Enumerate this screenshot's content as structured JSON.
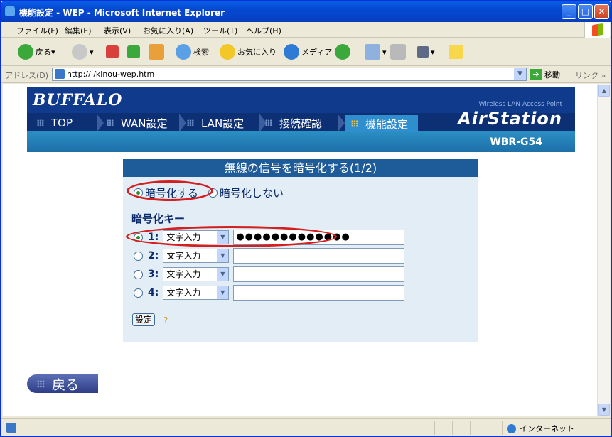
{
  "window": {
    "title": "機能設定 - WEP - Microsoft Internet Explorer"
  },
  "menu": [
    "ファイル(F)",
    "編集(E)",
    "表示(V)",
    "お気に入り(A)",
    "ツール(T)",
    "ヘルプ(H)"
  ],
  "toolbar": {
    "back": "戻る",
    "search": "検索",
    "favorites": "お気に入り",
    "media": "メディア"
  },
  "address": {
    "label": "アドレス(D)",
    "url": "http://            /kinou-wep.htm",
    "go": "移動",
    "links": "リンク"
  },
  "header": {
    "logo": "BUFFALO",
    "tabs": [
      "TOP",
      "WAN設定",
      "LAN設定",
      "接続確認",
      "機能設定"
    ],
    "active_tab": "機能設定",
    "product_sub": "Wireless LAN Access Point",
    "product": "AirStation",
    "model": "WBR-G54"
  },
  "panel": {
    "title": "無線の信号を暗号化する(1/2)",
    "encrypt_on": "暗号化する",
    "encrypt_off": "暗号化しない",
    "key_heading": "暗号化キー",
    "keys": [
      {
        "label": "1:",
        "mode": "文字入力",
        "value": "●●●●●●●●●●●●●",
        "selected": true
      },
      {
        "label": "2:",
        "mode": "文字入力",
        "value": "",
        "selected": false
      },
      {
        "label": "3:",
        "mode": "文字入力",
        "value": "",
        "selected": false
      },
      {
        "label": "4:",
        "mode": "文字入力",
        "value": "",
        "selected": false
      }
    ],
    "submit": "設定"
  },
  "back_button": "戻る",
  "status": {
    "zone": "インターネット"
  },
  "colors": {
    "highlight": "#D31F1F",
    "panel_header": "#1E5C99",
    "panel_bg": "#E3EDF5"
  }
}
